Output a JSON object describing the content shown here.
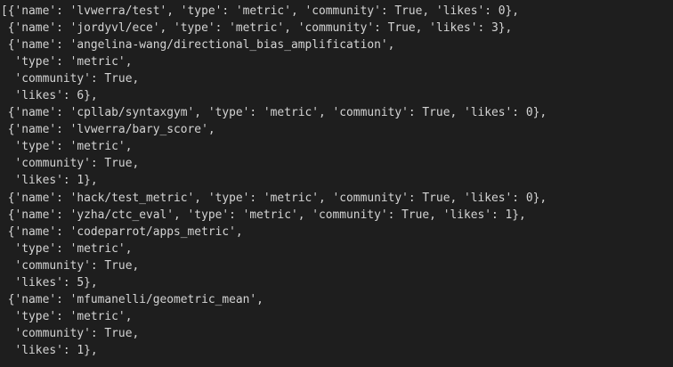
{
  "output": {
    "lines": [
      "[{'name': 'lvwerra/test', 'type': 'metric', 'community': True, 'likes': 0},",
      " {'name': 'jordyvl/ece', 'type': 'metric', 'community': True, 'likes': 3},",
      " {'name': 'angelina-wang/directional_bias_amplification',",
      "  'type': 'metric',",
      "  'community': True,",
      "  'likes': 6},",
      " {'name': 'cpllab/syntaxgym', 'type': 'metric', 'community': True, 'likes': 0},",
      " {'name': 'lvwerra/bary_score',",
      "  'type': 'metric',",
      "  'community': True,",
      "  'likes': 1},",
      " {'name': 'hack/test_metric', 'type': 'metric', 'community': True, 'likes': 0},",
      " {'name': 'yzha/ctc_eval', 'type': 'metric', 'community': True, 'likes': 1},",
      " {'name': 'codeparrot/apps_metric',",
      "  'type': 'metric',",
      "  'community': True,",
      "  'likes': 5},",
      " {'name': 'mfumanelli/geometric_mean',",
      "  'type': 'metric',",
      "  'community': True,",
      "  'likes': 1},"
    ]
  }
}
